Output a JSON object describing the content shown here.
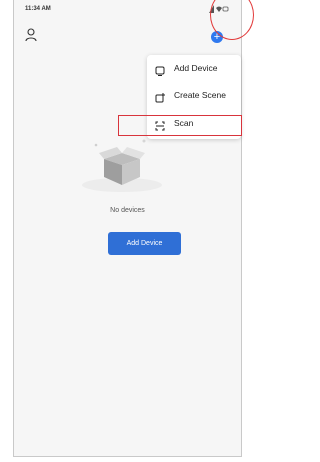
{
  "status_bar": {
    "time": "11:34 AM"
  },
  "header": {
    "profile_icon": "person-icon",
    "add_icon": "plus-icon",
    "add_symbol": "+"
  },
  "menu": {
    "items": [
      {
        "label": "Add Device",
        "icon": "add-device-icon"
      },
      {
        "label": "Create Scene",
        "icon": "create-scene-icon"
      },
      {
        "label": "Scan",
        "icon": "scan-icon"
      }
    ]
  },
  "empty_state": {
    "message": "No devices",
    "button_label": "Add Device",
    "illustration": "empty-box-illustration"
  },
  "colors": {
    "accent": "#2f6fd6",
    "annotation": "#e23a3a"
  }
}
